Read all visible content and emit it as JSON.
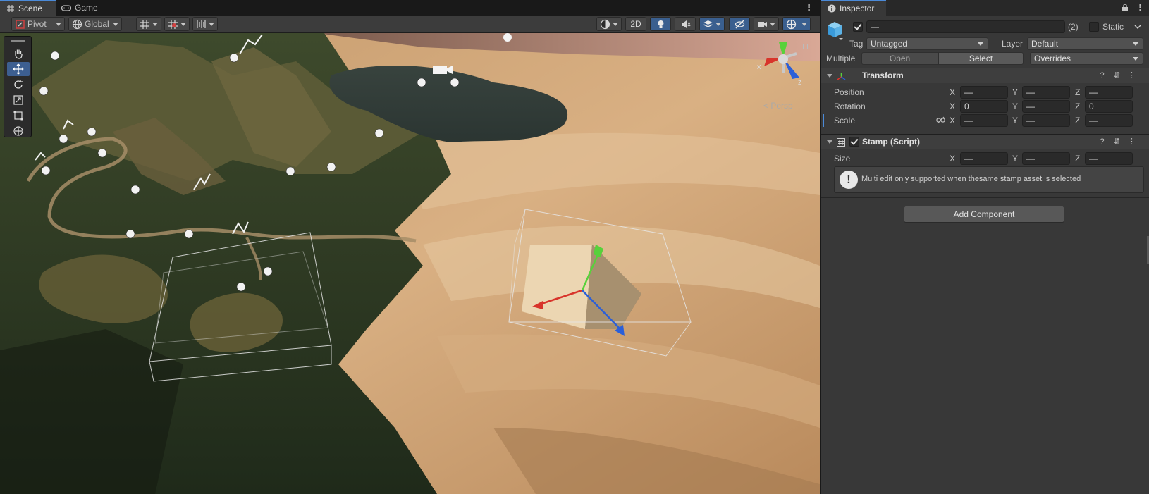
{
  "scene_window": {
    "tabs": [
      {
        "label": "Scene",
        "active": true,
        "icon": "grid-icon"
      },
      {
        "label": "Game",
        "active": false,
        "icon": "gamepad-icon"
      }
    ],
    "toolbar": {
      "pivot_label": "Pivot",
      "global_label": "Global",
      "mode_2d_label": "2D"
    },
    "tools": [
      "hand-tool-icon",
      "move-tool-icon",
      "rotate-tool-icon",
      "scale-tool-icon",
      "rect-tool-icon",
      "transform-tool-icon"
    ],
    "selected_tool": "move-tool-icon",
    "orientation_gizmo": {
      "x_label": "x",
      "z_label": "z",
      "mode_label": "Persp"
    }
  },
  "inspector": {
    "tab_label": "Inspector",
    "object": {
      "name_value": "—",
      "count_label": "(2)",
      "static_label": "Static",
      "tag_label": "Tag",
      "tag_value": "Untagged",
      "layer_label": "Layer",
      "layer_value": "Default",
      "multiple_label": "Multiple",
      "open_label": "Open",
      "select_label": "Select",
      "overrides_label": "Overrides"
    },
    "transform": {
      "title": "Transform",
      "position_label": "Position",
      "rotation_label": "Rotation",
      "scale_label": "Scale",
      "axis_x": "X",
      "axis_y": "Y",
      "axis_z": "Z",
      "position": {
        "x": "—",
        "y": "—",
        "z": "—"
      },
      "rotation": {
        "x": "0",
        "y": "—",
        "z": "0"
      },
      "scale": {
        "x": "—",
        "y": "—",
        "z": "—"
      }
    },
    "stamp": {
      "title": "Stamp (Script)",
      "size_label": "Size",
      "size": {
        "x": "—",
        "y": "—",
        "z": "—"
      },
      "help_message": "Multi edit only supported when thesame stamp asset is selected"
    },
    "add_component_label": "Add Component"
  },
  "colors": {
    "accent_blue": "#3d5f91",
    "panel_bg": "#383838",
    "gizmo_x": "#d8342b",
    "gizmo_y": "#58d13b",
    "gizmo_z": "#2b5fd8"
  }
}
